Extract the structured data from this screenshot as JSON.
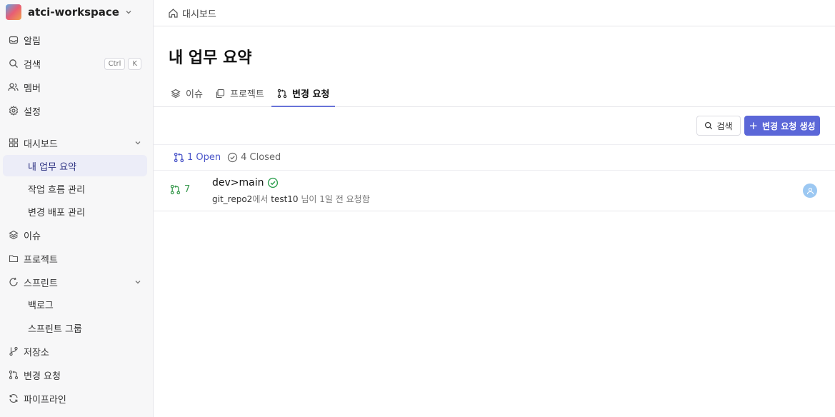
{
  "workspace": {
    "name": "atci-workspace"
  },
  "sidebar": {
    "top": [
      {
        "label": "알림",
        "icon": "inbox-icon"
      },
      {
        "label": "검색",
        "icon": "search-icon",
        "kbd": [
          "Ctrl",
          "K"
        ]
      },
      {
        "label": "멤버",
        "icon": "users-icon"
      },
      {
        "label": "설정",
        "icon": "gear-icon"
      }
    ],
    "dashboard": {
      "label": "대시보드",
      "items": [
        "내 업무 요약",
        "작업 흐름 관리",
        "변경 배포 관리"
      ]
    },
    "issues": "이슈",
    "projects": "프로젝트",
    "sprint": {
      "label": "스프린트",
      "items": [
        "백로그",
        "스프린트 그룹"
      ]
    },
    "repos": "저장소",
    "change_requests": "변경 요청",
    "pipeline": "파이프라인"
  },
  "breadcrumb": "대시보드",
  "page_title": "내 업무 요약",
  "tabs": [
    "이슈",
    "프로젝트",
    "변경 요청"
  ],
  "toolbar": {
    "search_label": "검색",
    "create_label": "변경 요청 생성"
  },
  "filters": {
    "open": "1 Open",
    "closed": "4 Closed"
  },
  "pull_request": {
    "number": "7",
    "title": "dev>main",
    "repo": "git_repo2",
    "meta_mid": "에서",
    "user": "test10",
    "meta_tail": "님이 1일 전 요청함"
  },
  "colors": {
    "accent": "#5b67d8",
    "open_green": "#3a9a4f",
    "status_ok": "#2fa050"
  }
}
